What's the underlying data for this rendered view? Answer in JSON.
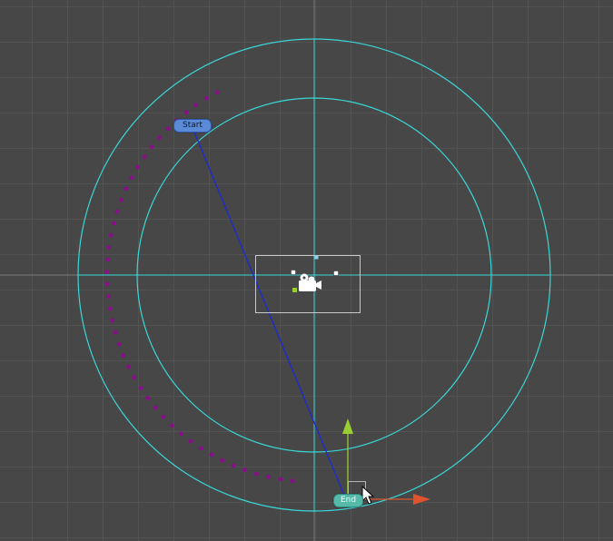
{
  "scene": {
    "background_color": "#474747",
    "grid_color": "#525252",
    "axis_color": "#6f6f6f",
    "guide_color": "#3ad7d7",
    "path_line_color": "#1a2bd6",
    "waypoint_color": "#8a0f8a"
  },
  "path": {
    "start_label": "Start",
    "end_label": "End"
  },
  "gizmo": {
    "y_axis_color": "#9acd32",
    "x_axis_color": "#e0532d",
    "camera_icon": "camera-icon",
    "cursor_icon": "mouse-pointer-icon"
  }
}
